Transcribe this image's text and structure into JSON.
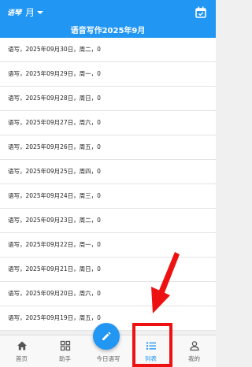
{
  "header": {
    "brand": "语琴",
    "period": "月",
    "subtitle": "语音写作2025年9月"
  },
  "rows": [
    "语写，2025年09月30日，周二，0",
    "语写，2025年09月29日，周一，0",
    "语写，2025年09月28日，周日，0",
    "语写，2025年09月27日，周六，0",
    "语写，2025年09月26日，周五，0",
    "语写，2025年09月25日，周四，0",
    "语写，2025年09月24日，周三，0",
    "语写，2025年09月23日，周二，0",
    "语写，2025年09月22日，周一，0",
    "语写，2025年09月21日，周日，0",
    "语写，2025年09月20日，周六，0",
    "语写，2025年09月19日，周五，0"
  ],
  "nav": {
    "tabs": [
      {
        "label": "首页",
        "icon": "home-icon"
      },
      {
        "label": "助手",
        "icon": "grid-icon"
      },
      {
        "label": "今日语写",
        "icon": "edit-icon"
      },
      {
        "label": "列表",
        "icon": "list-icon"
      },
      {
        "label": "我的",
        "icon": "person-icon"
      }
    ],
    "active": "列表"
  },
  "colors": {
    "primary": "#2196f3",
    "annotation": "#ee1111"
  }
}
